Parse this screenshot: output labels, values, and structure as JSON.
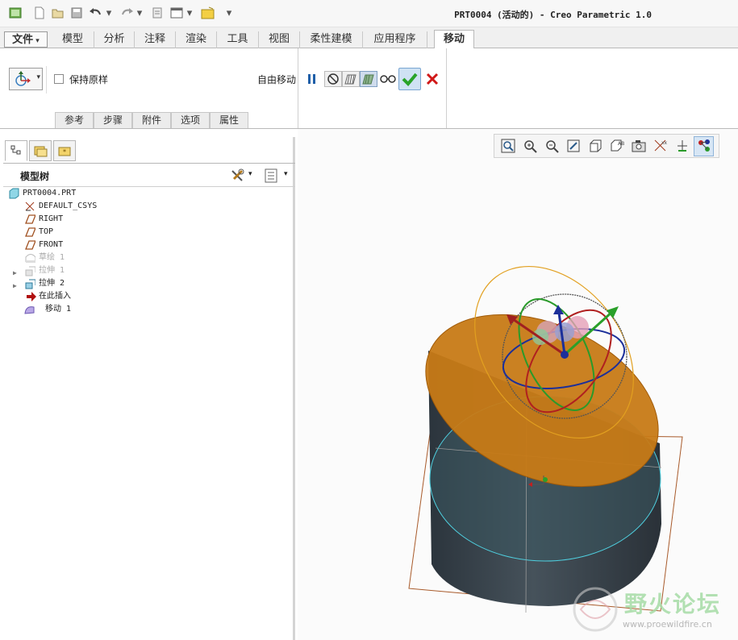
{
  "window": {
    "title": "PRT0004 (活动的) - Creo Parametric 1.0",
    "quick_access": [
      "new-icon",
      "open-icon",
      "save-icon",
      "undo-icon",
      "redo-icon",
      "regenerate-icon",
      "windows-icon",
      "close-window-icon",
      "customize-icon"
    ]
  },
  "ribbon": {
    "tabs": [
      "文件",
      "模型",
      "分析",
      "注释",
      "渲染",
      "工具",
      "视图",
      "柔性建模",
      "应用程序",
      "移动"
    ],
    "active_tab": "移动"
  },
  "dashboard": {
    "keep_original_label": "保持原样",
    "keep_original_checked": false,
    "free_move_label": "自由移动",
    "subtabs": [
      "参考",
      "步骤",
      "附件",
      "选项",
      "属性"
    ]
  },
  "model_tree": {
    "header": "模型树",
    "items": [
      {
        "label": "PRT0004.PRT",
        "icon": "part-icon",
        "dim": false,
        "expandable": false
      },
      {
        "label": "DEFAULT_CSYS",
        "icon": "csys-icon",
        "dim": false,
        "expandable": false
      },
      {
        "label": "RIGHT",
        "icon": "datum-plane-icon",
        "dim": false,
        "expandable": false
      },
      {
        "label": "TOP",
        "icon": "datum-plane-icon",
        "dim": false,
        "expandable": false
      },
      {
        "label": "FRONT",
        "icon": "datum-plane-icon",
        "dim": false,
        "expandable": false
      },
      {
        "label": "草绘 1",
        "icon": "sketch-icon",
        "dim": true,
        "expandable": false
      },
      {
        "label": "拉伸 1",
        "icon": "extrude-icon",
        "dim": true,
        "expandable": true
      },
      {
        "label": "拉伸 2",
        "icon": "extrude-icon",
        "dim": false,
        "expandable": true
      },
      {
        "label": "在此插入",
        "icon": "insert-here-arrow-icon",
        "dim": false,
        "expandable": false
      },
      {
        "label": "移动 1",
        "icon": "move-feature-icon",
        "dim": false,
        "expandable": false
      }
    ]
  },
  "view_toolbar": [
    "refit-icon",
    "zoom-in-icon",
    "zoom-out-icon",
    "repaint-icon",
    "display-style-icon",
    "saved-views-icon",
    "view-manager-icon",
    "datum-display-icon",
    "spin-center-icon",
    "annotation-display-icon",
    "dragger-icon"
  ],
  "watermark": {
    "title": "野火论坛",
    "url": "www.proewildfire.cn"
  },
  "colors": {
    "accent_blue": "#3a7fc0",
    "confirm_green": "#29a329",
    "cancel_red": "#d01818",
    "face_orange": "#c77a16",
    "cylinder_dark": "#3a4650"
  }
}
